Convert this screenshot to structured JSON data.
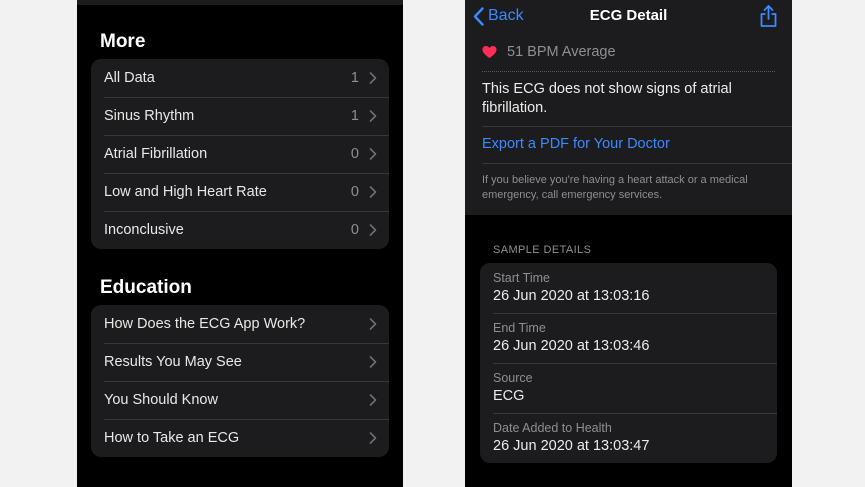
{
  "left": {
    "more": {
      "title": "More",
      "items": [
        {
          "label": "All Data",
          "count": "1"
        },
        {
          "label": "Sinus Rhythm",
          "count": "1"
        },
        {
          "label": "Atrial Fibrillation",
          "count": "0"
        },
        {
          "label": "Low and High Heart Rate",
          "count": "0"
        },
        {
          "label": "Inconclusive",
          "count": "0"
        }
      ]
    },
    "education": {
      "title": "Education",
      "items": [
        {
          "label": "How Does the ECG App Work?"
        },
        {
          "label": "Results You May See"
        },
        {
          "label": "You Should Know"
        },
        {
          "label": "How to Take an ECG"
        }
      ]
    }
  },
  "right": {
    "nav": {
      "back_label": "Back",
      "title": "ECG Detail"
    },
    "summary": {
      "bpm": "51 BPM Average",
      "result": "This ECG does not show signs of atrial fibrillation.",
      "export": "Export a PDF for Your Doctor",
      "disclaimer": "If you believe you're having a heart attack or a medical emergency, call emergency services."
    },
    "sample": {
      "header": "SAMPLE DETAILS",
      "rows": [
        {
          "label": "Start Time",
          "value": "26 Jun 2020 at 13:03:16"
        },
        {
          "label": "End Time",
          "value": "26 Jun 2020 at 13:03:46"
        },
        {
          "label": "Source",
          "value": "ECG"
        },
        {
          "label": "Date Added to Health",
          "value": "26 Jun 2020 at 13:03:47"
        }
      ]
    }
  },
  "colors": {
    "accent": "#3a8bff",
    "heart": "#ff2d55",
    "background": "#000000",
    "cell": "#1c1c1e"
  }
}
